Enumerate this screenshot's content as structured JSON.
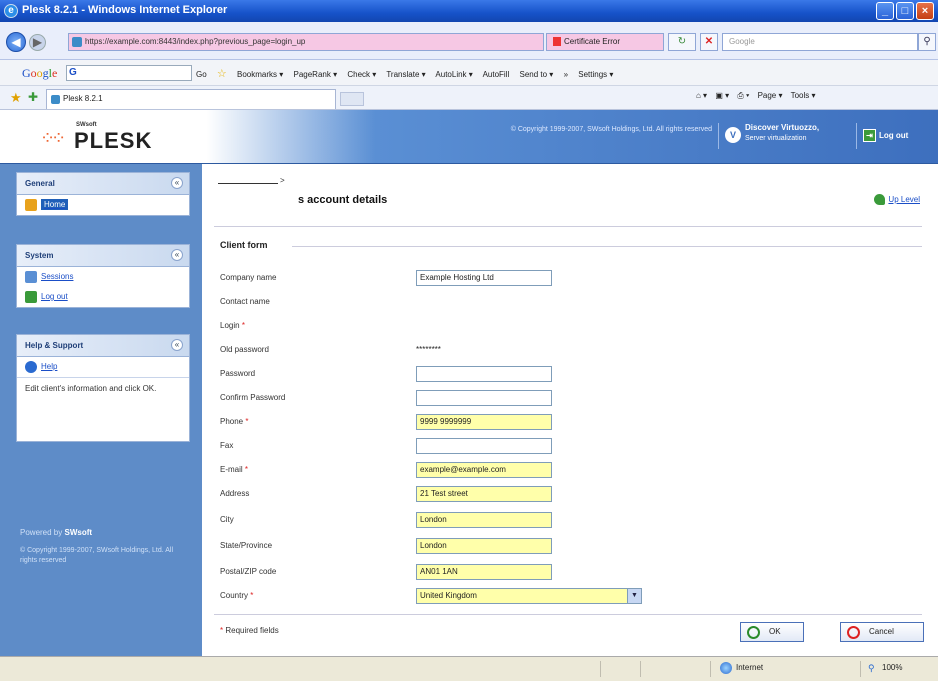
{
  "window": {
    "title": "Plesk 8.2.1 - Windows Internet Explorer",
    "minimize": "_",
    "maximize": "□",
    "close": "×"
  },
  "browser": {
    "url": "https://example.com:8443/index.php?previous_page=login_up",
    "cert_error": "Certificate Error",
    "search_placeholder": "Google",
    "tab_title": "Plesk 8.2.1",
    "toolbar": {
      "search_prefix": "G",
      "items": [
        "Go",
        "Bookmarks ▾",
        "PageRank ▾",
        "Check ▾",
        "Translate ▾",
        "AutoLink ▾",
        "AutoFill",
        "Send to ▾",
        "»",
        "Settings ▾"
      ]
    },
    "cmdbar": [
      "⌂ ▾",
      "▣ ▾",
      "⎙ ▾",
      "Page ▾",
      "Tools ▾"
    ],
    "status": {
      "zone": "Internet",
      "zoom": "100%"
    }
  },
  "header": {
    "brand_small": "SWsoft",
    "brand": "PLESK",
    "copyright": "© Copyright 1999-2007, SWsoft Holdings, Ltd. All rights reserved",
    "discover_title": "Discover Virtuozzo,",
    "discover_sub": "Server virtualization",
    "logout": "Log out"
  },
  "sidebar": {
    "general": {
      "title": "General",
      "items": [
        {
          "label": "Home"
        }
      ]
    },
    "system": {
      "title": "System",
      "items": [
        {
          "label": "Sessions"
        },
        {
          "label": "Log out"
        }
      ]
    },
    "help": {
      "title": "Help & Support",
      "items": [
        {
          "label": "Help"
        }
      ],
      "text": "Edit client's information and click OK."
    },
    "powered_by": "Powered by",
    "powered_brand": "SWsoft",
    "copyright": "© Copyright 1999-2007, SWsoft Holdings, Ltd. All rights reserved"
  },
  "main": {
    "breadcrumb_sep": ">",
    "title": "s account details",
    "up_level": "Up Level",
    "legend": "Client form",
    "fields": {
      "company": {
        "label": "Company name",
        "value": "Example Hosting Ltd"
      },
      "contact": {
        "label": "Contact name"
      },
      "login": {
        "label": "Login"
      },
      "old_password": {
        "label": "Old password",
        "value": "********"
      },
      "password": {
        "label": "Password",
        "value": ""
      },
      "confirm_password": {
        "label": "Confirm Password",
        "value": ""
      },
      "phone": {
        "label": "Phone",
        "value": "9999 9999999"
      },
      "fax": {
        "label": "Fax",
        "value": ""
      },
      "email": {
        "label": "E-mail",
        "value": "example@example.com"
      },
      "address": {
        "label": "Address",
        "value": "21 Test street"
      },
      "city": {
        "label": "City",
        "value": "London"
      },
      "state": {
        "label": "State/Province",
        "value": "London"
      },
      "postal": {
        "label": "Postal/ZIP code",
        "value": "AN01 1AN"
      },
      "country": {
        "label": "Country",
        "value": "United Kingdom"
      }
    },
    "required_star": "*",
    "required_note": "Required fields",
    "ok": "OK",
    "cancel": "Cancel"
  }
}
